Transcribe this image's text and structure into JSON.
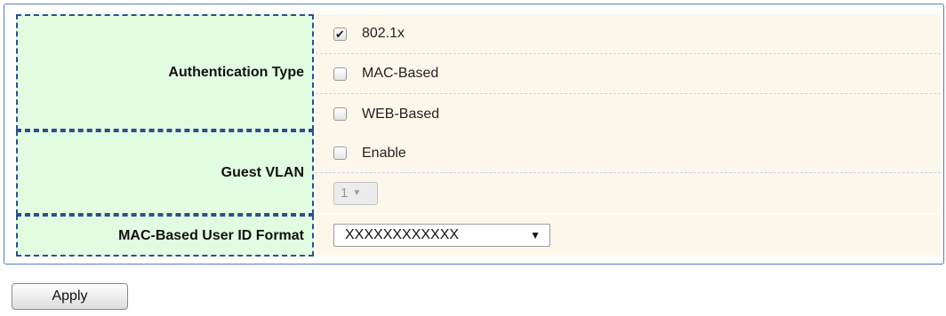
{
  "form": {
    "auth_type": {
      "label": "Authentication Type",
      "options": [
        {
          "label": "802.1x",
          "checked": true
        },
        {
          "label": "MAC-Based",
          "checked": false
        },
        {
          "label": "WEB-Based",
          "checked": false
        }
      ]
    },
    "guest_vlan": {
      "label": "Guest VLAN",
      "enable_label": "Enable",
      "enable_checked": false,
      "vlan_value": "1"
    },
    "mac_format": {
      "label": "MAC-Based User ID Format",
      "value": "XXXXXXXXXXXX"
    }
  },
  "actions": {
    "apply_label": "Apply"
  },
  "icons": {
    "check": "check-icon",
    "dropdown": "chevron-down-icon"
  },
  "colors": {
    "label_bg": "#e1fce0",
    "value_bg": "#fbf7eb",
    "border": "#2d4e8f"
  }
}
